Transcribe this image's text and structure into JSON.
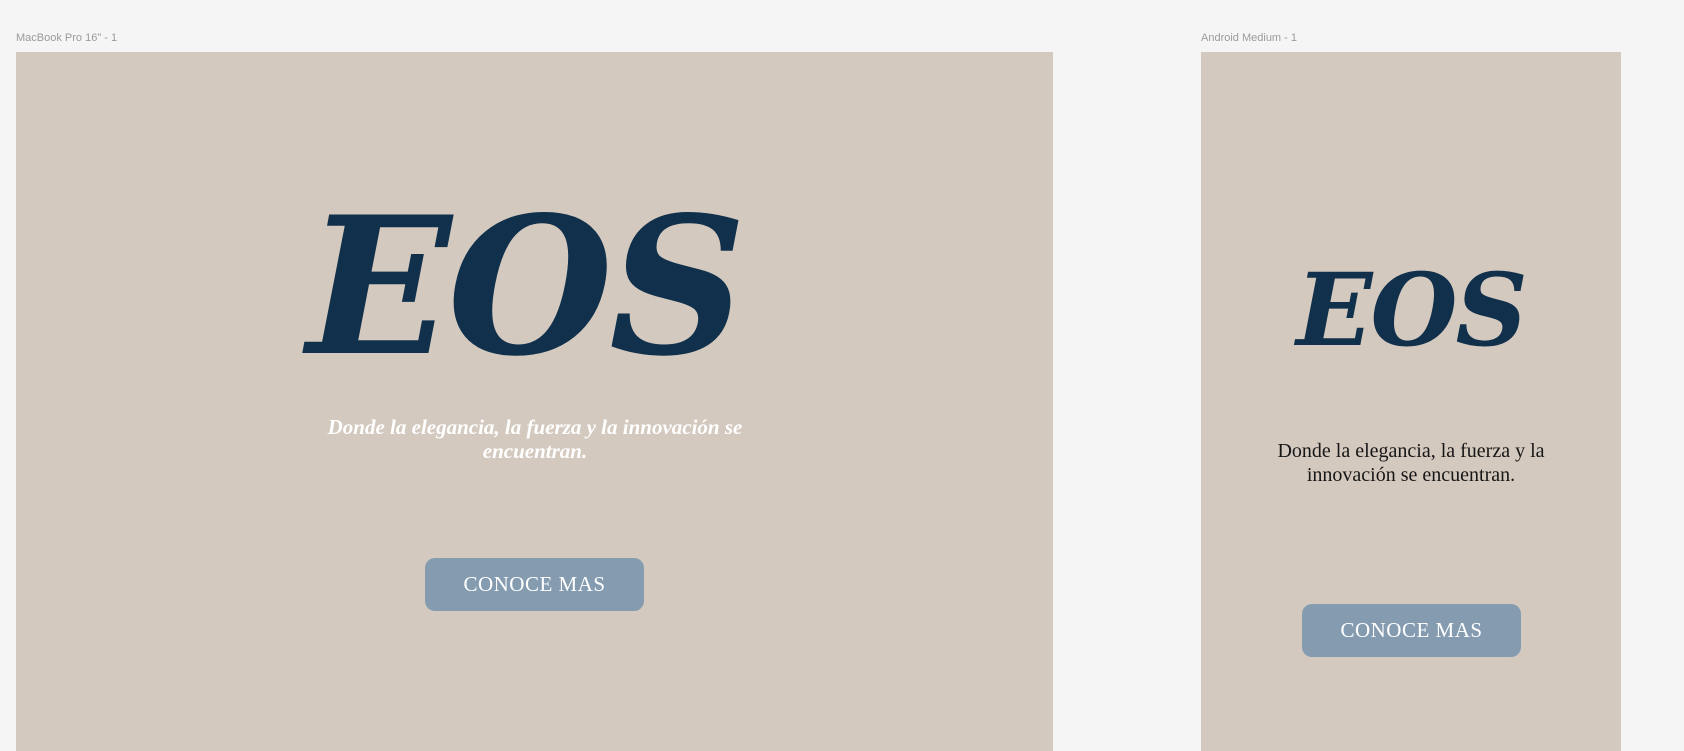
{
  "frames": {
    "desktop": {
      "label": "MacBook Pro 16\" - 1",
      "logo": "EOS",
      "tagline": "Donde la elegancia, la fuerza y la innovación se encuentran.",
      "cta_label": "CONOCE MAS"
    },
    "mobile": {
      "label": "Android Medium - 1",
      "logo": "EOS",
      "tagline": "Donde la elegancia, la fuerza y la innovación se encuentran.",
      "cta_label": "CONOCE MAS"
    }
  },
  "colors": {
    "canvas": "#f5f5f5",
    "frame_background": "#d4c9bf",
    "logo": "#10304b",
    "button": "#849bb0",
    "desktop_tagline": "#ffffff",
    "mobile_tagline": "#161616"
  }
}
